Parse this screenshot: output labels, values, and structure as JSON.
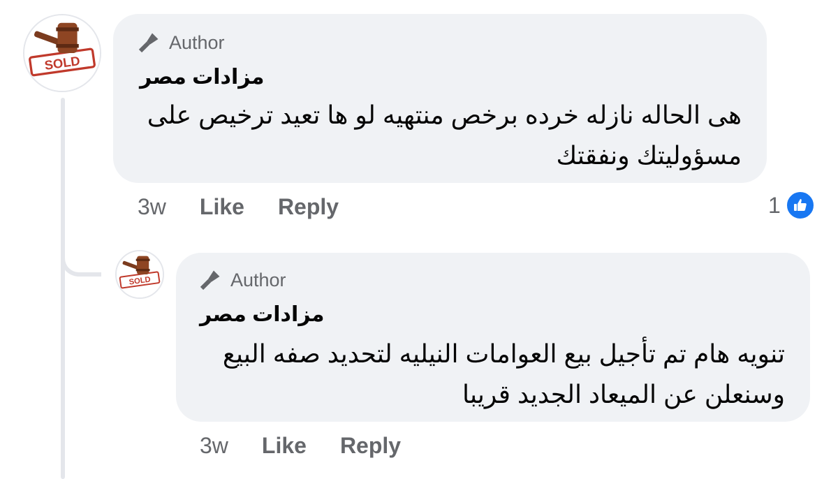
{
  "comments": [
    {
      "badge": "Author",
      "name": "مزادات مصر",
      "text": "هى الحاله نازله خرده برخص منتهيه لو ها تعيد ترخيص على مسؤوليتك ونفقتك",
      "time": "3w",
      "like_label": "Like",
      "reply_label": "Reply",
      "reaction_count": "1"
    },
    {
      "badge": "Author",
      "name": "مزادات مصر",
      "text": "تنويه هام تم تأجيل بيع العوامات النيليه لتحديد صفه البيع وسنعلن عن الميعاد الجديد قريبا",
      "time": "3w",
      "like_label": "Like",
      "reply_label": "Reply"
    }
  ],
  "icons": {
    "badge": "microphone-icon",
    "reaction": "thumbs-up-icon",
    "avatar": "auction-gavel-sold-logo"
  },
  "colors": {
    "bubble": "#f0f2f5",
    "secondary_text": "#65676b",
    "like_blue": "#1877f2"
  }
}
